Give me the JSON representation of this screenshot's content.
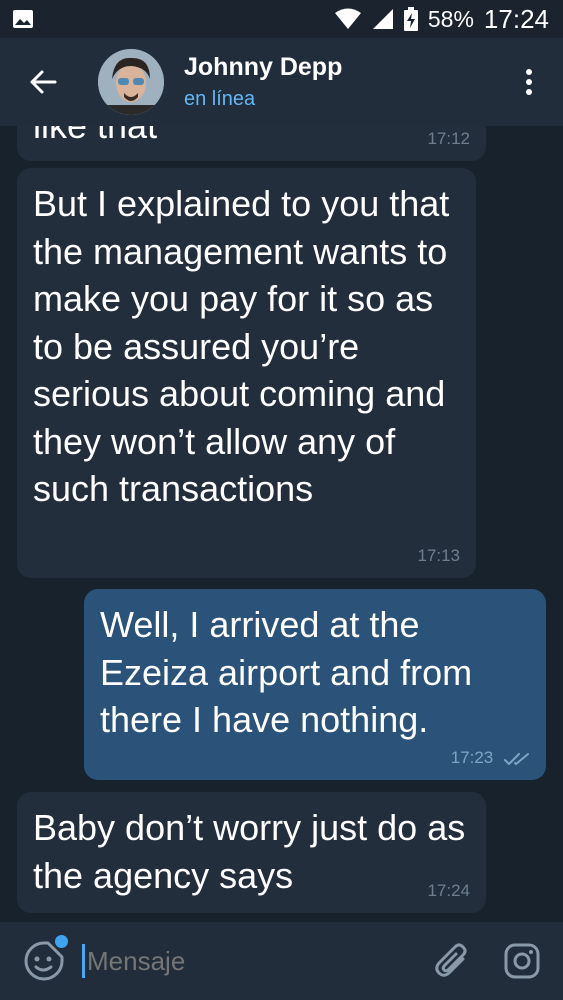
{
  "status_bar": {
    "battery": "58%",
    "time": "17:24"
  },
  "header": {
    "contact_name": "Johnny Depp",
    "status": "en línea"
  },
  "messages": [
    {
      "direction": "incoming",
      "text": "like that",
      "time": "17:12"
    },
    {
      "direction": "incoming",
      "text": "But I explained to you that the management wants to make you pay for it so as to be assured you’re serious about coming and they won’t allow any of such transactions",
      "time": "17:13"
    },
    {
      "direction": "outgoing",
      "text": "Well, I arrived at the Ezeiza airport and from there I have nothing.",
      "time": "17:23",
      "read": true
    },
    {
      "direction": "incoming",
      "text": "Baby don’t worry just do as the agency says",
      "time": "17:24"
    }
  ],
  "composer": {
    "placeholder": "Mensaje"
  },
  "icons": {
    "back": "arrow-left-icon",
    "menu": "more-vertical-icon",
    "emoji": "sticker-icon",
    "attach": "paperclip-icon",
    "camera": "instagram-camera-icon"
  },
  "colors": {
    "incoming_bubble": "#232e3c",
    "outgoing_bubble": "#2b5278",
    "accent": "#63b7f2",
    "background": "#18222d"
  }
}
